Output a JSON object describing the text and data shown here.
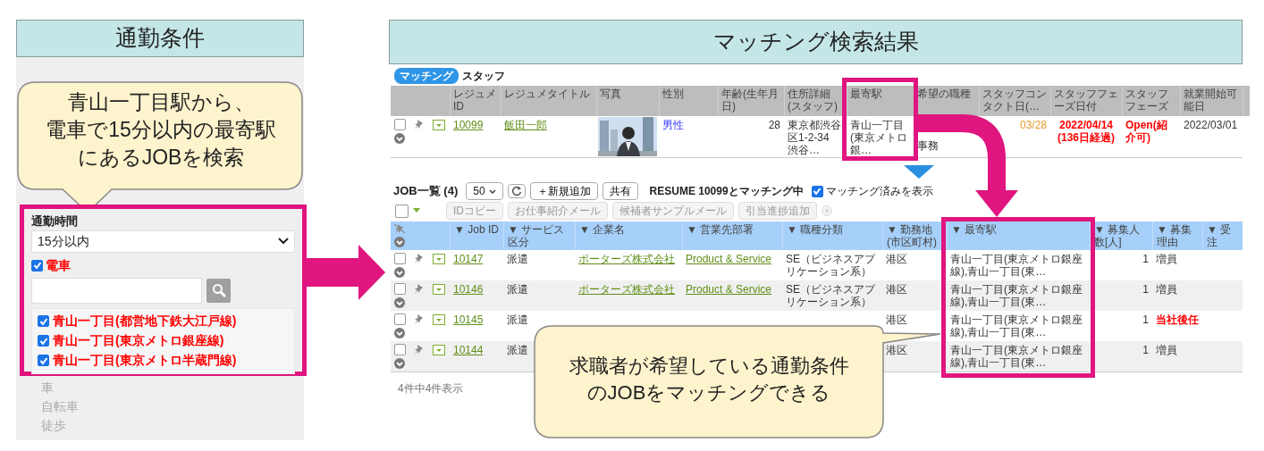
{
  "left_panel": {
    "title": "通勤条件",
    "callout": [
      "青山一丁目駅から、",
      "電車で15分以内の最寄駅",
      "にあるJOBを検索"
    ],
    "commute_time": {
      "label": "通勤時間",
      "value": "15分以内"
    },
    "train": {
      "label": "電車",
      "checked": true
    },
    "stations": [
      {
        "label": "青山一丁目(都営地下鉄大江戸線)",
        "checked": true
      },
      {
        "label": "青山一丁目(東京メトロ銀座線)",
        "checked": true
      },
      {
        "label": "青山一丁目(東京メトロ半蔵門線)",
        "checked": true
      }
    ],
    "other_modes": [
      {
        "label": "車",
        "checked": false
      },
      {
        "label": "自転車",
        "checked": false
      },
      {
        "label": "徒歩",
        "checked": false
      }
    ]
  },
  "right_panel": {
    "title": "マッチング検索結果",
    "staff": {
      "badge": "マッチング",
      "title": "スタッフ",
      "columns": [
        "レジュメID",
        "レジュメタイトル",
        "写真",
        "性別",
        "年齢(生年月日)",
        "住所詳細(スタッフ)",
        "最寄駅",
        "希望の職種",
        "スタッフコンタクト日(…",
        "スタッフフェーズ日付",
        "スタッフフェーズ",
        "就業開始可能日"
      ],
      "row": {
        "checked": false,
        "cells": [
          {
            "kind": "link",
            "text": "10099"
          },
          {
            "kind": "link",
            "text": "飯田一郎"
          },
          {
            "kind": "picture"
          },
          {
            "kind": "male",
            "text": "男性"
          },
          {
            "kind": "number",
            "text": "28"
          },
          {
            "kind": "text",
            "text": "東京都渋谷区1-2-34 渋谷…"
          },
          {
            "kind": "text",
            "text": "青山一丁目(東京メトロ銀…"
          },
          {
            "kind": "lower",
            "text": "事務"
          },
          {
            "kind": "warn",
            "text": "03/28"
          },
          {
            "kind": "alert",
            "text": "2022/04/14 (136日経過)"
          },
          {
            "kind": "alert",
            "text": "Open(紹介可)"
          },
          {
            "kind": "text",
            "text": "2022/03/01"
          }
        ]
      }
    },
    "jobs": {
      "title": "JOB一覧 (4)",
      "page_size": "50",
      "add_button": "＋新規追加",
      "share_button": "共有",
      "matching_status": "RESUME 10099とマッチング中",
      "show_matched": {
        "label": "マッチング済みを表示",
        "checked": true
      },
      "select_all": {
        "checked": false
      },
      "actions": [
        {
          "label": "IDコピー",
          "disabled": true
        },
        {
          "label": "お仕事紹介メール",
          "disabled": true
        },
        {
          "label": "候補者サンプルメール",
          "disabled": true
        },
        {
          "label": "引当進捗追加",
          "disabled": true
        }
      ],
      "columns": [
        "▼ Job ID",
        "▼ サービス区分",
        "▼ 企業名",
        "▼ 営業先部署",
        "▼ 職種分類",
        "▼ 勤務地(市区町村)",
        "▼ 最寄駅",
        "▼ 募集人数[人]",
        "▼ 募集理由",
        "▼ 受注"
      ],
      "rows": [
        {
          "checked": false,
          "cells": [
            {
              "kind": "link",
              "text": "10147"
            },
            {
              "kind": "text",
              "text": "派遣"
            },
            {
              "kind": "link",
              "text": "ポーターズ株式会社"
            },
            {
              "kind": "link",
              "text": "Product & Service"
            },
            {
              "kind": "text",
              "text": "SE（ビジネスアプリケーション系）"
            },
            {
              "kind": "text",
              "text": "港区"
            },
            {
              "kind": "text",
              "text": "青山一丁目(東京メトロ銀座線),青山一丁目(東…"
            },
            {
              "kind": "number",
              "text": "1"
            },
            {
              "kind": "text",
              "text": "増員"
            }
          ]
        },
        {
          "checked": false,
          "cells": [
            {
              "kind": "link",
              "text": "10146"
            },
            {
              "kind": "text",
              "text": "派遣"
            },
            {
              "kind": "link",
              "text": "ポーターズ株式会社"
            },
            {
              "kind": "link",
              "text": "Product & Service"
            },
            {
              "kind": "text",
              "text": "SE（ビジネスアプリケーション系）"
            },
            {
              "kind": "text",
              "text": "港区"
            },
            {
              "kind": "text",
              "text": "青山一丁目(東京メトロ銀座線),青山一丁目(東…"
            },
            {
              "kind": "number",
              "text": "1"
            },
            {
              "kind": "text",
              "text": "増員"
            }
          ]
        },
        {
          "checked": false,
          "cells": [
            {
              "kind": "link",
              "text": "10145"
            },
            {
              "kind": "text",
              "text": "派遣"
            },
            null,
            null,
            null,
            {
              "kind": "text",
              "text": "港区"
            },
            {
              "kind": "text",
              "text": "青山一丁目(東京メトロ銀座線),青山一丁目(東…"
            },
            {
              "kind": "number",
              "text": "1"
            },
            {
              "kind": "alert",
              "text": "当社後任"
            }
          ]
        },
        {
          "checked": false,
          "cells": [
            {
              "kind": "link",
              "text": "10144"
            },
            {
              "kind": "text",
              "text": "派遣"
            },
            null,
            null,
            null,
            {
              "kind": "text",
              "text": "港区"
            },
            {
              "kind": "text",
              "text": "青山一丁目(東京メトロ銀座線),青山一丁目(東…"
            },
            {
              "kind": "number",
              "text": "1"
            },
            {
              "kind": "text",
              "text": "増員"
            }
          ]
        }
      ],
      "footer": "4件中4件表示"
    },
    "callout": [
      "求職者が希望している通勤条件",
      "のJOBをマッチングできる"
    ]
  }
}
